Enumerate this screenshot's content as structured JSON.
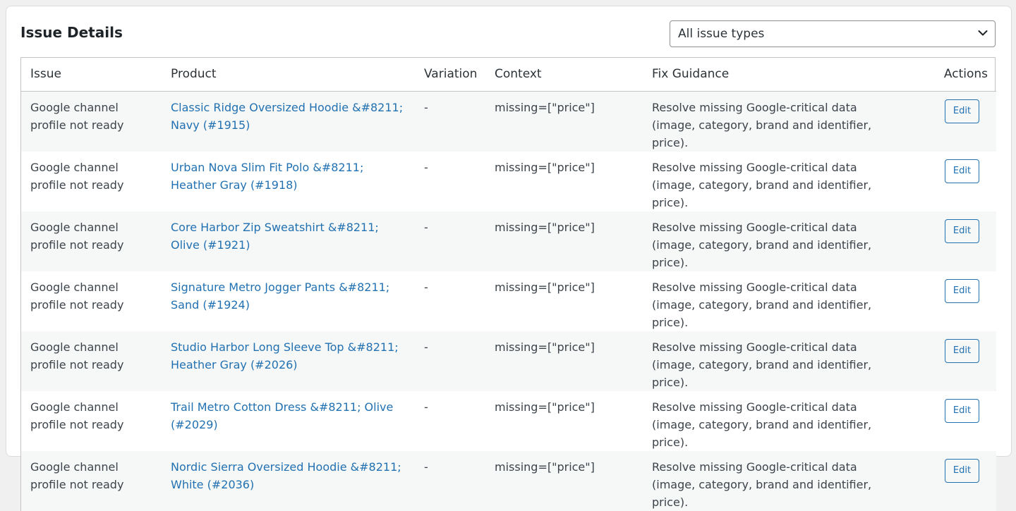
{
  "section": {
    "title": "Issue Details",
    "filter_selected": "All issue types"
  },
  "table": {
    "headers": {
      "issue": "Issue",
      "product": "Product",
      "variation": "Variation",
      "context": "Context",
      "fix": "Fix Guidance",
      "actions": "Actions"
    },
    "rows": [
      {
        "issue": "Google channel profile not ready",
        "product": "Classic Ridge Oversized Hoodie &#8211; Navy (#1915)",
        "variation": "-",
        "context": "missing=[\"price\"]",
        "fix": "Resolve missing Google-critical data (image, category, brand and identifier, price).",
        "action": "Edit"
      },
      {
        "issue": "Google channel profile not ready",
        "product": "Urban Nova Slim Fit Polo &#8211; Heather Gray (#1918)",
        "variation": "-",
        "context": "missing=[\"price\"]",
        "fix": "Resolve missing Google-critical data (image, category, brand and identifier, price).",
        "action": "Edit"
      },
      {
        "issue": "Google channel profile not ready",
        "product": "Core Harbor Zip Sweatshirt &#8211; Olive (#1921)",
        "variation": "-",
        "context": "missing=[\"price\"]",
        "fix": "Resolve missing Google-critical data (image, category, brand and identifier, price).",
        "action": "Edit"
      },
      {
        "issue": "Google channel profile not ready",
        "product": "Signature Metro Jogger Pants &#8211; Sand (#1924)",
        "variation": "-",
        "context": "missing=[\"price\"]",
        "fix": "Resolve missing Google-critical data (image, category, brand and identifier, price).",
        "action": "Edit"
      },
      {
        "issue": "Google channel profile not ready",
        "product": "Studio Harbor Long Sleeve Top &#8211; Heather Gray (#2026)",
        "variation": "-",
        "context": "missing=[\"price\"]",
        "fix": "Resolve missing Google-critical data (image, category, brand and identifier, price).",
        "action": "Edit"
      },
      {
        "issue": "Google channel profile not ready",
        "product": "Trail Metro Cotton Dress &#8211; Olive (#2029)",
        "variation": "-",
        "context": "missing=[\"price\"]",
        "fix": "Resolve missing Google-critical data (image, category, brand and identifier, price).",
        "action": "Edit"
      },
      {
        "issue": "Google channel profile not ready",
        "product": "Nordic Sierra Oversized Hoodie &#8211; White (#2036)",
        "variation": "-",
        "context": "missing=[\"price\"]",
        "fix": "Resolve missing Google-critical data (image, category, brand and identifier, price).",
        "action": "Edit"
      }
    ]
  },
  "icons": {
    "dropdown": "chevron-down-icon"
  },
  "colors": {
    "link": "#2271b1",
    "row_alt": "#f6f7f7",
    "border": "#c3c4c7"
  }
}
